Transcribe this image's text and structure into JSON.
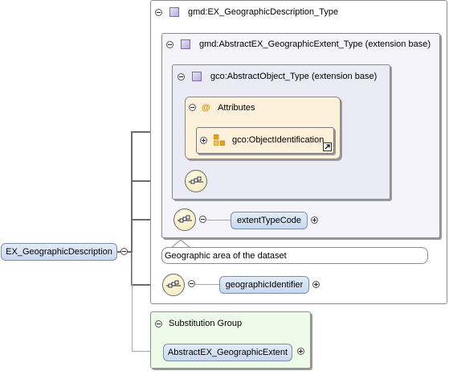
{
  "root_element": {
    "label": "EX_GeographicDescription"
  },
  "outer_type": {
    "label": "gmd:EX_GeographicDescription_Type"
  },
  "extent_type": {
    "label": "gmd:AbstractEX_GeographicExtent_Type (extension base)"
  },
  "object_type": {
    "label": "gco:AbstractObject_Type (extension base)"
  },
  "attributes": {
    "label": "Attributes",
    "symbol": "@",
    "group": "gco:ObjectIdentification"
  },
  "extent_type_code": {
    "label": "extentTypeCode"
  },
  "documentation": {
    "text": "Geographic area of the dataset"
  },
  "geographic_identifier": {
    "label": "geographicIdentifier"
  },
  "substitution_group": {
    "label": "Substitution Group",
    "member": "AbstractEX_GeographicExtent"
  },
  "colors": {
    "attributes_bg": "#fdf1dc",
    "substitution_bg": "#effbe9",
    "element_fill": "#d6e2f3",
    "type_bg": "#f3f3fb"
  }
}
